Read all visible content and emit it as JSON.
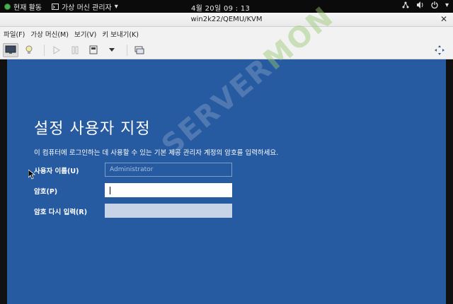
{
  "topbar": {
    "activities": "현재 활동",
    "app_menu": "가상 머신 관리자",
    "clock": "4월 20일  09 : 13"
  },
  "window": {
    "title": "win2k22/QEMU/KVM"
  },
  "menu": {
    "items": [
      "파일(F)",
      "가상 머신(M)",
      "보기(V)",
      "키 보내기(K)"
    ]
  },
  "icons": {
    "topbar": [
      "green-status-icon",
      "app-menu-icon",
      "network-icon",
      "volume-icon",
      "power-icon"
    ],
    "toolbar": [
      "monitor-icon",
      "lightbulb-icon",
      "play-icon",
      "pause-icon",
      "shutdown-icon",
      "dropdown-arrow-icon",
      "screenshot-icon",
      "fullscreen-icon"
    ]
  },
  "vm_screen": {
    "heading": "설정 사용자 지정",
    "instruction": "이 컴퓨터에 로그인하는 데 사용할 수 있는 기본 제공 관리자 계정의 암호를 입력하세요.",
    "username_label": "사용자 이름(U)",
    "username_value": "Administrator",
    "password_label": "암호(P)",
    "password_value": "",
    "confirm_label": "암호 다시 입력(R)",
    "confirm_value": ""
  },
  "watermark": {
    "text_main": "SERVER",
    "text_accent": "MON"
  },
  "colors": {
    "vm_background": "#265aa1",
    "topbar": "#0b0b0b",
    "window_chrome": "#f2f2f2"
  }
}
